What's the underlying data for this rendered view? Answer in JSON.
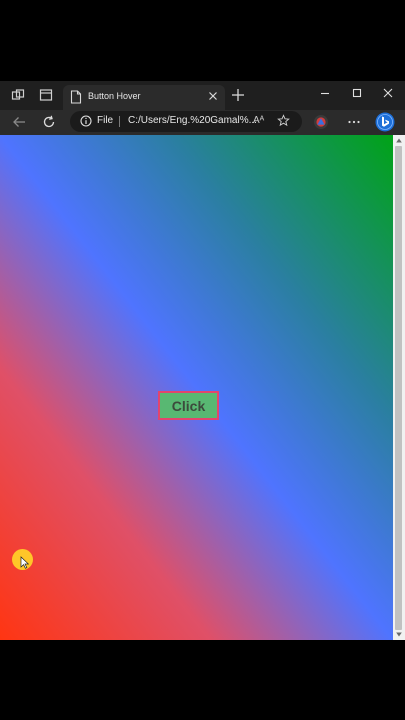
{
  "tab": {
    "title": "Button Hover"
  },
  "address_bar": {
    "scheme_label": "File",
    "url": "C:/Users/Eng.%20Gamal%...",
    "read_aloud_label": "Aᴬ"
  },
  "page": {
    "button_label": "Click"
  },
  "icons": {
    "workspaces": "workspaces-icon",
    "tab_actions": "tab-actions-icon",
    "page": "document-icon",
    "close_tab": "close-icon",
    "new_tab": "plus-icon",
    "minimize": "minimize-icon",
    "maximize": "maximize-icon",
    "close_window": "close-icon",
    "back": "back-arrow-icon",
    "refresh": "refresh-icon",
    "info": "info-icon",
    "favorite": "star-icon",
    "profile": "profile-icon",
    "menu": "more-icon",
    "copilot": "bing-icon"
  },
  "colors": {
    "button_fill": "#58b872",
    "button_border": "#e2456d",
    "gradient_bottom_left": "#ff3512",
    "gradient_center": "#4f74ff",
    "gradient_top_right": "#00a316",
    "cursor_highlight": "#ffce28"
  }
}
